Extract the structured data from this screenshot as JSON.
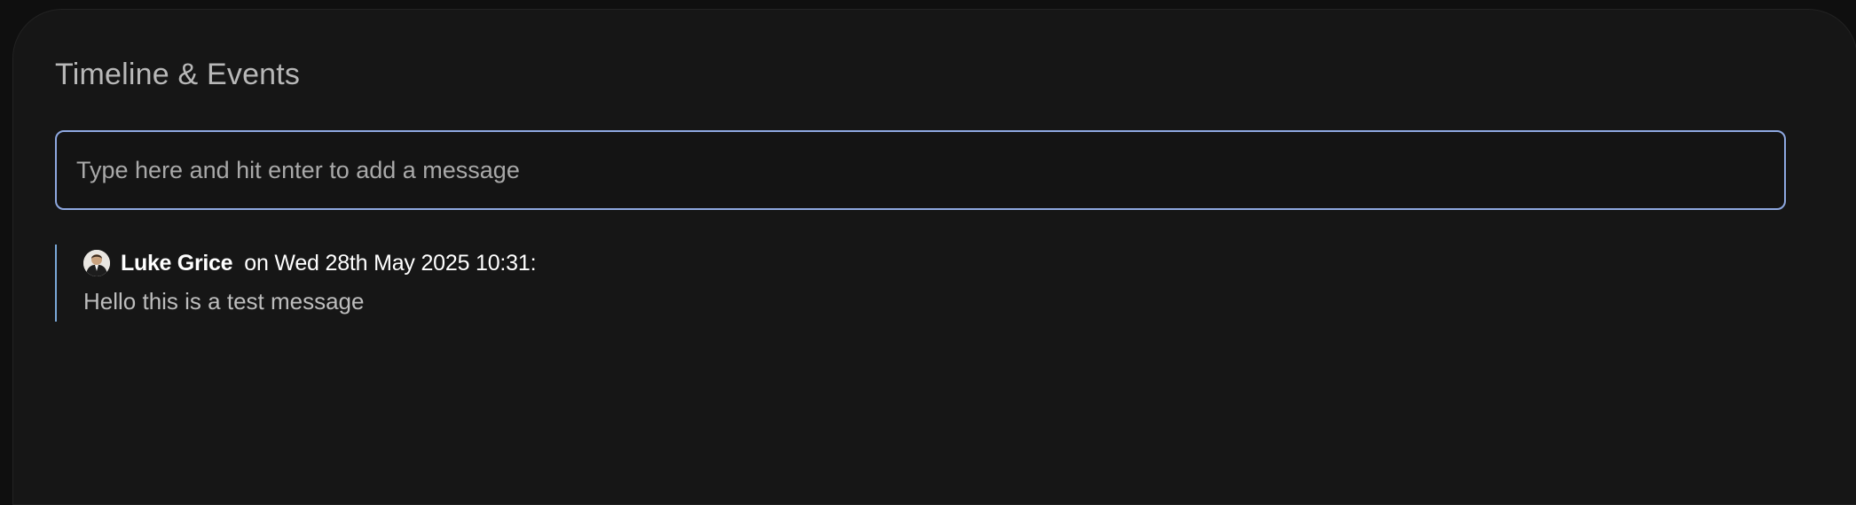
{
  "panel": {
    "title": "Timeline & Events"
  },
  "composer": {
    "placeholder": "Type here and hit enter to add a message",
    "value": ""
  },
  "timeline": {
    "entries": [
      {
        "author": "Luke Grice",
        "timestamp_text": "on Wed 28th May 2025 10:31:",
        "message": "Hello this is a test message",
        "avatar_icon": "user-avatar"
      }
    ]
  },
  "colors": {
    "background": "#0f0f0f",
    "panel": "#161616",
    "input_border": "#8ea8e0",
    "entry_accent": "#7aa8d8"
  }
}
